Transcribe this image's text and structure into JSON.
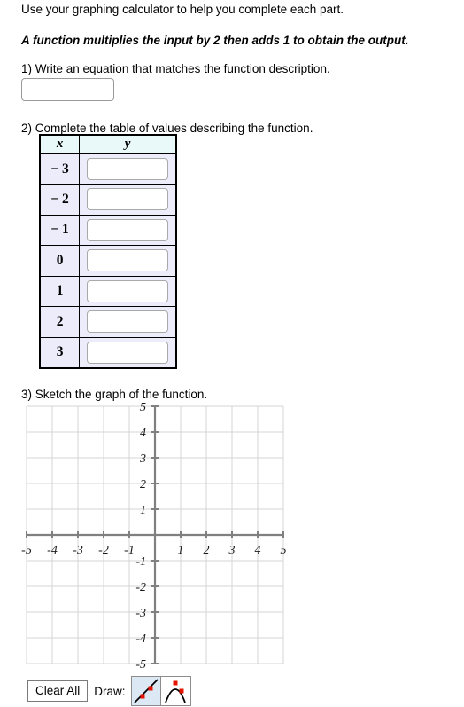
{
  "intro": {
    "line1": "Use your graphing calculator to help you complete each part.",
    "line2": "A function multiplies the input by 2 then adds 1 to obtain the output."
  },
  "questions": {
    "q1": {
      "label": "1) Write an equation that matches the function description.",
      "answer_value": "",
      "answer_placeholder": ""
    },
    "q2": {
      "label": "2) Complete the table of values describing the function.",
      "table": {
        "headers": [
          "x",
          "y"
        ],
        "rows": [
          {
            "x": "− 3",
            "y": ""
          },
          {
            "x": "− 2",
            "y": ""
          },
          {
            "x": "− 1",
            "y": ""
          },
          {
            "x": "0",
            "y": ""
          },
          {
            "x": "1",
            "y": ""
          },
          {
            "x": "2",
            "y": ""
          },
          {
            "x": "3",
            "y": ""
          }
        ],
        "header_bg": "#e9f9f9",
        "cell_bg": "#ececfa"
      }
    },
    "q3": {
      "label": "3) Sketch the graph of the function."
    }
  },
  "chart_data": {
    "type": "scatter",
    "title": "",
    "xlabel": "",
    "ylabel": "",
    "xlim": [
      -5,
      5
    ],
    "ylim": [
      -5,
      5
    ],
    "x_ticks": [
      -5,
      -4,
      -3,
      -2,
      -1,
      1,
      2,
      3,
      4,
      5
    ],
    "y_ticks": [
      5,
      4,
      3,
      2,
      1,
      -1,
      -2,
      -3,
      -4,
      -5
    ],
    "x_tick_labels": [
      "-5",
      "-4",
      "-3",
      "-2",
      "-1",
      "1",
      "2",
      "3",
      "4",
      "5"
    ],
    "y_tick_labels": [
      "5",
      "4",
      "3",
      "2",
      "1",
      "-1",
      "-2",
      "-3",
      "-4",
      "-5"
    ],
    "grid": true,
    "grid_color": "#d4d4d4",
    "axis_color": "#808080",
    "legend": "none",
    "series": [],
    "values": []
  },
  "toolbar": {
    "clear_all_label": "Clear All",
    "draw_label": "Draw:",
    "tools": [
      {
        "name": "line-tool",
        "selected": true,
        "selected_bg": "#dce9f5"
      },
      {
        "name": "parabola-tool",
        "selected": false,
        "selected_bg": "#ffffff"
      }
    ],
    "point_color": "#e51400"
  }
}
